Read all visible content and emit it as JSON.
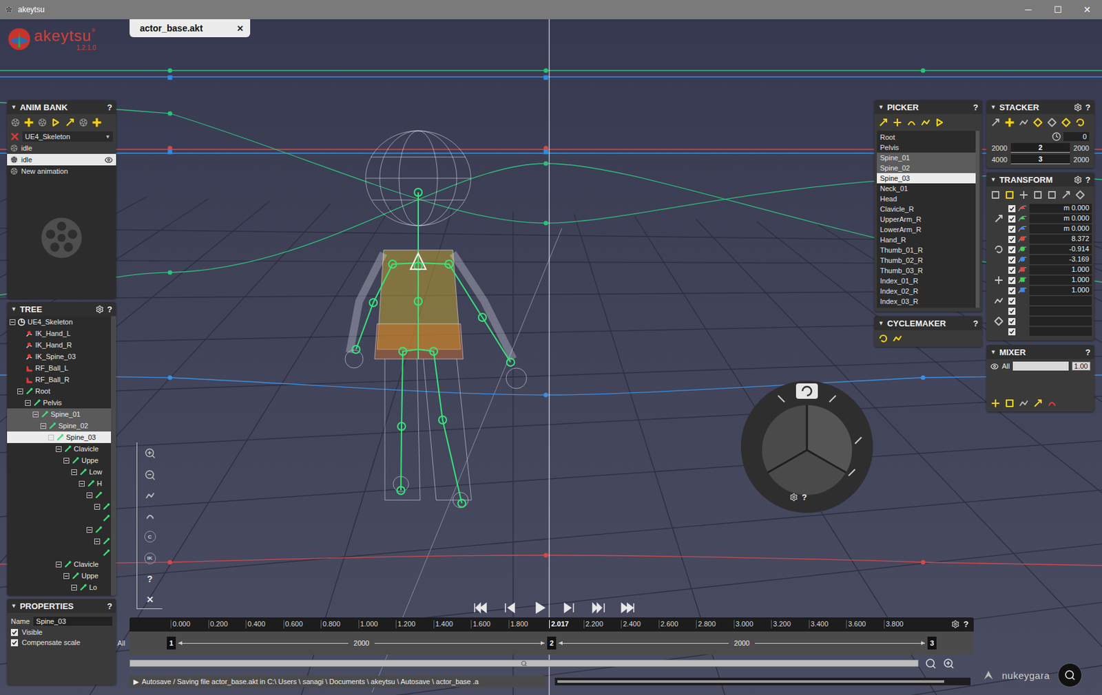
{
  "window": {
    "title": "akeytsu",
    "controls": [
      "─",
      "☐",
      "✕"
    ]
  },
  "logo": {
    "name": "akeytsu",
    "mark": "®",
    "version": "1.2.1.0"
  },
  "document_tab": {
    "label": "actor_base.akt",
    "close": "✕"
  },
  "panel_toggle": "▼",
  "anim_bank": {
    "title": "ANIM BANK",
    "help": "?",
    "skeleton": "UE4_Skeleton",
    "dropdown": "▼",
    "base_animation": "idle",
    "animations": [
      {
        "label": "idle",
        "selected": true,
        "visible": true
      },
      {
        "label": "New animation",
        "selected": false,
        "visible": false
      }
    ]
  },
  "tree": {
    "title": "TREE",
    "help": "?",
    "nodes": [
      {
        "label": "UE4_Skeleton",
        "depth": 0,
        "kind": "skeleton",
        "expanded": true,
        "selected": false,
        "highlighted": false
      },
      {
        "label": "IK_Hand_L",
        "depth": 1,
        "kind": "ik",
        "expanded": false,
        "selected": false,
        "highlighted": false
      },
      {
        "label": "IK_Hand_R",
        "depth": 1,
        "kind": "ik",
        "expanded": false,
        "selected": false,
        "highlighted": false
      },
      {
        "label": "IK_Spine_03",
        "depth": 1,
        "kind": "ik",
        "expanded": false,
        "selected": false,
        "highlighted": false
      },
      {
        "label": "RF_Ball_L",
        "depth": 1,
        "kind": "rf",
        "expanded": false,
        "selected": false,
        "highlighted": false
      },
      {
        "label": "RF_Ball_R",
        "depth": 1,
        "kind": "rf",
        "expanded": false,
        "selected": false,
        "highlighted": false
      },
      {
        "label": "Root",
        "depth": 1,
        "kind": "bone",
        "expanded": true,
        "selected": false,
        "highlighted": false
      },
      {
        "label": "Pelvis",
        "depth": 2,
        "kind": "bone",
        "expanded": true,
        "selected": false,
        "highlighted": false
      },
      {
        "label": "Spine_01",
        "depth": 3,
        "kind": "bone",
        "expanded": true,
        "selected": false,
        "highlighted": true
      },
      {
        "label": "Spine_02",
        "depth": 4,
        "kind": "bone",
        "expanded": true,
        "selected": false,
        "highlighted": true
      },
      {
        "label": "Spine_03",
        "depth": 5,
        "kind": "bone",
        "expanded": true,
        "selected": true,
        "highlighted": false
      },
      {
        "label": "Clavicle",
        "depth": 6,
        "kind": "bone",
        "expanded": true,
        "selected": false,
        "highlighted": false
      },
      {
        "label": "Uppe",
        "depth": 7,
        "kind": "bone",
        "expanded": true,
        "selected": false,
        "highlighted": false
      },
      {
        "label": "Low",
        "depth": 8,
        "kind": "bone",
        "expanded": true,
        "selected": false,
        "highlighted": false
      },
      {
        "label": "H",
        "depth": 9,
        "kind": "bone",
        "expanded": true,
        "selected": false,
        "highlighted": false
      },
      {
        "label": "",
        "depth": 10,
        "kind": "bone",
        "expanded": true,
        "selected": false,
        "highlighted": false
      },
      {
        "label": "",
        "depth": 11,
        "kind": "bone",
        "expanded": true,
        "selected": false,
        "highlighted": false
      },
      {
        "label": "",
        "depth": 11,
        "kind": "bone",
        "expanded": false,
        "selected": false,
        "highlighted": false
      },
      {
        "label": "",
        "depth": 10,
        "kind": "bone",
        "expanded": true,
        "selected": false,
        "highlighted": false
      },
      {
        "label": "",
        "depth": 11,
        "kind": "bone",
        "expanded": true,
        "selected": false,
        "highlighted": false
      },
      {
        "label": "",
        "depth": 11,
        "kind": "bone",
        "expanded": false,
        "selected": false,
        "highlighted": false
      },
      {
        "label": "Clavicle",
        "depth": 6,
        "kind": "bone",
        "expanded": true,
        "selected": false,
        "highlighted": false
      },
      {
        "label": "Uppe",
        "depth": 7,
        "kind": "bone",
        "expanded": true,
        "selected": false,
        "highlighted": false
      },
      {
        "label": "Lo",
        "depth": 8,
        "kind": "bone",
        "expanded": true,
        "selected": false,
        "highlighted": false
      }
    ]
  },
  "properties": {
    "title": "PROPERTIES",
    "help": "?",
    "name_label": "Name",
    "name_value": "Spine_03",
    "options": [
      {
        "label": "Visible",
        "checked": true
      },
      {
        "label": "Compensate scale",
        "checked": true
      }
    ]
  },
  "picker": {
    "title": "PICKER",
    "help": "?",
    "items": [
      {
        "label": "Root",
        "selected": false,
        "highlighted": false
      },
      {
        "label": "Pelvis",
        "selected": false,
        "highlighted": false
      },
      {
        "label": "Spine_01",
        "selected": false,
        "highlighted": true
      },
      {
        "label": "Spine_02",
        "selected": false,
        "highlighted": true
      },
      {
        "label": "Spine_03",
        "selected": true,
        "highlighted": false
      },
      {
        "label": "Neck_01",
        "selected": false,
        "highlighted": false
      },
      {
        "label": "Head",
        "selected": false,
        "highlighted": false
      },
      {
        "label": "Clavicle_R",
        "selected": false,
        "highlighted": false
      },
      {
        "label": "UpperArm_R",
        "selected": false,
        "highlighted": false
      },
      {
        "label": "LowerArm_R",
        "selected": false,
        "highlighted": false
      },
      {
        "label": "Hand_R",
        "selected": false,
        "highlighted": false
      },
      {
        "label": "Thumb_01_R",
        "selected": false,
        "highlighted": false
      },
      {
        "label": "Thumb_02_R",
        "selected": false,
        "highlighted": false
      },
      {
        "label": "Thumb_03_R",
        "selected": false,
        "highlighted": false
      },
      {
        "label": "Index_01_R",
        "selected": false,
        "highlighted": false
      },
      {
        "label": "Index_02_R",
        "selected": false,
        "highlighted": false
      },
      {
        "label": "Index_03_R",
        "selected": false,
        "highlighted": false
      }
    ]
  },
  "cyclemaker": {
    "title": "CYCLEMAKER",
    "help": "?"
  },
  "stacker": {
    "title": "STACKER",
    "help": "?",
    "offset": "0",
    "layers": [
      {
        "start": "2000",
        "value": "2",
        "end": "2000"
      },
      {
        "start": "4000",
        "value": "3",
        "end": "2000"
      }
    ]
  },
  "transform": {
    "title": "TRANSFORM",
    "help": "?",
    "groups": [
      {
        "kind": "translate",
        "rows": [
          {
            "value": "m 0.000",
            "checked": true,
            "color": "#e04848"
          },
          {
            "value": "m 0.000",
            "checked": true,
            "color": "#3fd25a"
          },
          {
            "value": "m 0.000",
            "checked": true,
            "color": "#3c8cf0"
          }
        ]
      },
      {
        "kind": "rotate",
        "rows": [
          {
            "value": "8.372",
            "checked": true,
            "color": "#e04848"
          },
          {
            "value": "-0.914",
            "checked": true,
            "color": "#3fd25a"
          },
          {
            "value": "-3.169",
            "checked": true,
            "color": "#3c8cf0"
          }
        ]
      },
      {
        "kind": "scale",
        "rows": [
          {
            "value": "1.000",
            "checked": true,
            "color": "#e04848"
          },
          {
            "value": "1.000",
            "checked": true,
            "color": "#3fd25a"
          },
          {
            "value": "1.000",
            "checked": true,
            "color": "#3c8cf0"
          }
        ]
      },
      {
        "kind": "pin",
        "rows": [
          {
            "value": "",
            "checked": true,
            "color": ""
          }
        ]
      },
      {
        "kind": "foot",
        "rows": [
          {
            "value": "",
            "checked": true,
            "color": ""
          },
          {
            "value": "",
            "checked": true,
            "color": ""
          },
          {
            "value": "",
            "checked": true,
            "color": ""
          }
        ]
      }
    ]
  },
  "mixer": {
    "title": "MIXER",
    "help": "?",
    "layers": [
      {
        "label": "All",
        "value": "1.00",
        "visible": true,
        "level": 1
      }
    ]
  },
  "viewport": {
    "tool_labels": [
      "C",
      "IK",
      "?",
      "✕"
    ],
    "gizmo_help": "?"
  },
  "timeline": {
    "all_label": "All",
    "current": "2.017",
    "help": "?",
    "ticks": [
      "0.000",
      "0.200",
      "0.400",
      "0.600",
      "0.800",
      "1.000",
      "1.200",
      "1.400",
      "1.600",
      "1.800",
      "2.200",
      "2.400",
      "2.600",
      "2.800",
      "3.000",
      "3.200",
      "3.400",
      "3.600",
      "3.800"
    ],
    "keys": [
      {
        "label": "1",
        "interval": "2000"
      },
      {
        "label": "2",
        "interval": "2000"
      },
      {
        "label": "3",
        "interval": ""
      }
    ]
  },
  "status_bar": {
    "arrow": "▶",
    "message": "Autosave / Saving file actor_base.akt in C:\\ Users \\ sanagi \\ Documents \\ akeytsu \\ Autosave \\ actor_base .a",
    "level": 0.93
  },
  "brand": {
    "name": "nukeygara"
  }
}
